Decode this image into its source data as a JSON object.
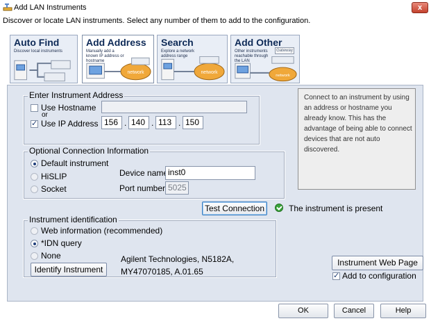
{
  "window": {
    "title": "Add LAN Instruments",
    "close_label": "x",
    "subtitle": "Discover or locate LAN instruments. Select any number of them to add to the configuration."
  },
  "tabs": [
    {
      "title": "Auto Find",
      "desc": "Discover local instruments",
      "art": "network-computer-icon"
    },
    {
      "title": "Add Address",
      "desc": "Manually add a known IP address or hostname",
      "art": "network-icon",
      "badge": "network"
    },
    {
      "title": "Search",
      "desc": "Explore a network address range",
      "art": "network-icon",
      "badge": "network"
    },
    {
      "title": "Add Other",
      "desc": "Other instruments reachable through the LAN",
      "art": "network-icon",
      "badge": "network",
      "gateway": "Gateway"
    }
  ],
  "address_group": {
    "label": "Enter Instrument Address",
    "hostname_label": "Use Hostname",
    "or_label": "or",
    "ip_label": "Use IP Address",
    "ip_octets": [
      "156",
      "140",
      "113",
      "150"
    ],
    "hostname_checked": false,
    "ip_checked": true
  },
  "help_text": "Connect to an instrument by using an address or hostname you already know. This has the advantage of being able to connect devices that are not auto discovered.",
  "connection_group": {
    "label": "Optional Connection Information",
    "options": [
      "Default instrument",
      "HiSLIP",
      "Socket"
    ],
    "selected": "Default instrument",
    "device_name_label": "Device name:",
    "device_name_value": "inst0",
    "port_label": "Port number:",
    "port_value": "5025"
  },
  "test": {
    "button_label": "Test Connection",
    "status_text": "The instrument is present"
  },
  "identification_group": {
    "label": "Instrument identification",
    "options": [
      "Web information (recommended)",
      "*IDN query",
      "None"
    ],
    "selected": "*IDN query",
    "identify_button": "Identify Instrument",
    "result_line1": "Agilent Technologies, N5182A,",
    "result_line2": "MY47070185, A.01.65"
  },
  "web_page_button": "Instrument Web Page",
  "add_to_config_label": "Add to configuration",
  "add_to_config_checked": true,
  "footer": {
    "ok": "OK",
    "cancel": "Cancel",
    "help": "Help"
  },
  "colors": {
    "panel_bg": "#dfe5ef",
    "tab_title": "#0e2a57",
    "status_ok": "#3aa43a",
    "close_btn": "#c4432e"
  }
}
